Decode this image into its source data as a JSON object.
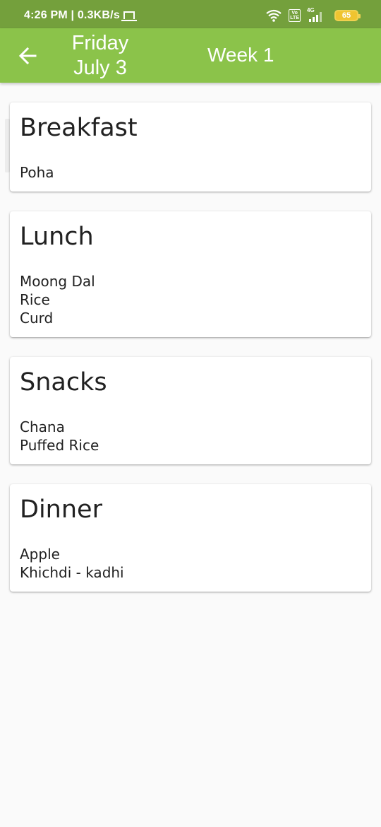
{
  "status_bar": {
    "time_speed": "4:26 PM | 0.3KB/s",
    "volte_top": "Vo",
    "volte_bottom": "LTE",
    "network": "4G",
    "battery": "65",
    "icons": [
      "laptop-icon",
      "wifi-icon",
      "volte-icon",
      "signal-icon",
      "battery-icon"
    ]
  },
  "app_bar": {
    "day": "Friday",
    "date": "July 3",
    "week": "Week 1",
    "back_icon": "arrow-left-icon"
  },
  "meals": [
    {
      "title": "Breakfast",
      "items": [
        "Poha"
      ]
    },
    {
      "title": "Lunch",
      "items": [
        "Moong Dal",
        "Rice",
        "Curd"
      ]
    },
    {
      "title": "Snacks",
      "items": [
        "Chana",
        "Puffed Rice"
      ]
    },
    {
      "title": "Dinner",
      "items": [
        "Apple",
        "Khichdi - kadhi"
      ]
    }
  ],
  "colors": {
    "status_bar": "#74a03c",
    "app_bar": "#8bc34a",
    "background": "#fafafa",
    "card": "#ffffff",
    "text": "#212121",
    "battery": "#f0c430"
  }
}
